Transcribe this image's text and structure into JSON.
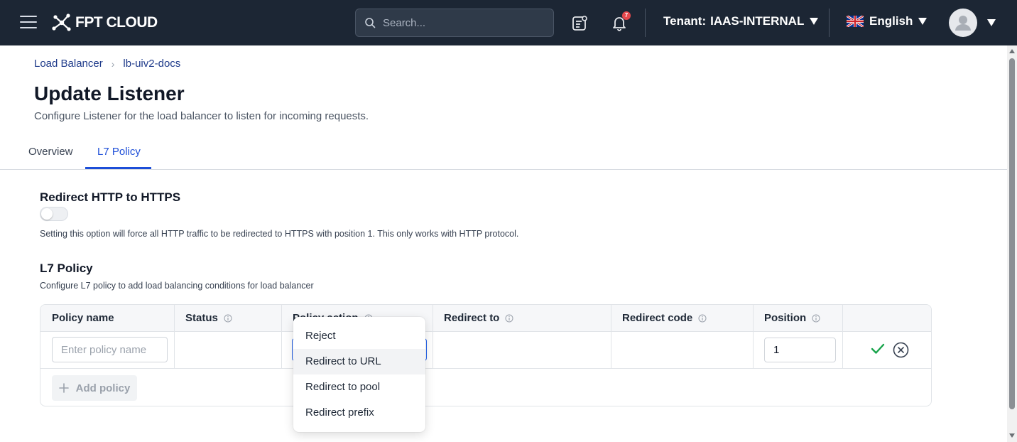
{
  "header": {
    "logo_text": "FPT CLOUD",
    "search_placeholder": "Search...",
    "notification_count": "7",
    "tenant_label": "Tenant:",
    "tenant_value": "IAAS-INTERNAL",
    "language": "English"
  },
  "breadcrumb": [
    "Load Balancer",
    "lb-uiv2-docs"
  ],
  "page": {
    "title": "Update Listener",
    "subtitle": "Configure Listener for the load balancer to listen for incoming requests."
  },
  "tabs": [
    {
      "label": "Overview",
      "active": false
    },
    {
      "label": "L7 Policy",
      "active": true
    }
  ],
  "redirect": {
    "title": "Redirect HTTP to HTTPS",
    "enabled": false,
    "help": "Setting this option will force all HTTP traffic to be redirected to HTTPS with position 1. This only works with HTTP protocol."
  },
  "l7policy": {
    "title": "L7 Policy",
    "help": "Configure L7 policy to add load balancing conditions for load balancer",
    "columns": [
      "Policy name",
      "Status",
      "Policy action",
      "Redirect to",
      "Redirect code",
      "Position"
    ],
    "row": {
      "policy_name_placeholder": "Enter policy name",
      "position_value": "1"
    },
    "add_label": "Add policy"
  },
  "dropdown": {
    "options": [
      "Reject",
      "Redirect to URL",
      "Redirect to pool",
      "Redirect prefix"
    ],
    "hovered": "Redirect to URL"
  },
  "colors": {
    "header_bg": "#1c2634",
    "accent": "#1d4ed8",
    "confirm": "#16a34a"
  }
}
